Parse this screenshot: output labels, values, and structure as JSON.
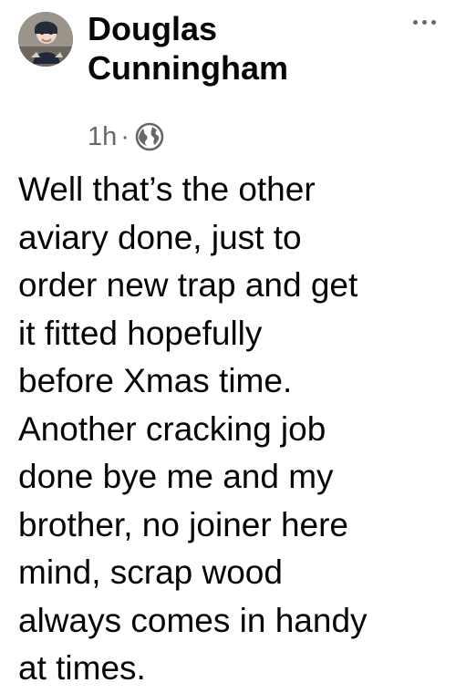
{
  "post": {
    "author": "Douglas Cunningham",
    "timestamp": "1h",
    "separator": "·",
    "audience_icon": "globe-icon",
    "options_icon": "more-options-icon",
    "text": "Well that’s the other\naviary done, just to\norder new trap and get\nit fitted hopefully\nbefore Xmas time.\nAnother cracking job\ndone bye me and my\nbrother, no joiner here\nmind, scrap wood\nalways comes in handy\nat times."
  }
}
